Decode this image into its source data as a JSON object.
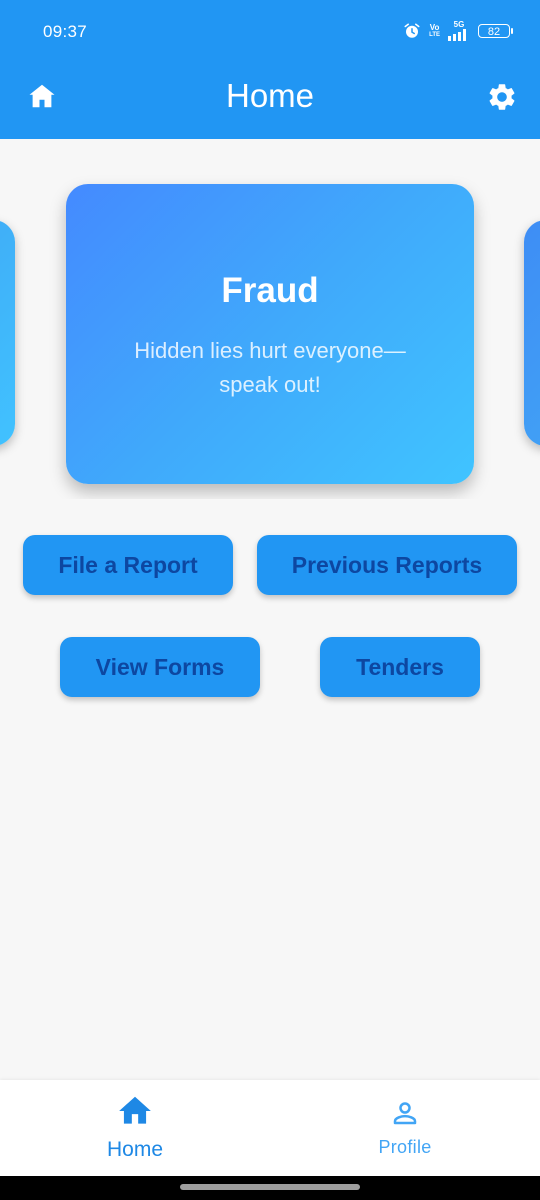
{
  "status_bar": {
    "time": "09:37",
    "icons": [
      "alarm-icon",
      "volte-icon",
      "signal-5g-icon",
      "battery-icon"
    ],
    "volte_top": "Vo",
    "volte_bottom": "LTE",
    "network": "5G",
    "battery": "82"
  },
  "app_bar": {
    "title": "Home",
    "left_icon": "home-icon",
    "right_icon": "settings-icon",
    "background": "#2196F3"
  },
  "carousel": {
    "current_card": {
      "title": "Fraud",
      "subtitle": "Hidden lies hurt everyone—speak out!"
    }
  },
  "actions": {
    "file_report": "File a Report",
    "previous_reports": "Previous Reports",
    "view_forms": "View Forms",
    "tenders": "Tenders"
  },
  "bottom_nav": {
    "items": [
      {
        "label": "Home",
        "icon": "home-icon",
        "selected": true
      },
      {
        "label": "Profile",
        "icon": "person-icon",
        "selected": false
      }
    ]
  },
  "colors": {
    "primary": "#2196F3",
    "button_text": "#0D47A1",
    "background": "#F7F7F7",
    "card_gradient_start": "#448AFF",
    "card_gradient_end": "#40C4FF"
  }
}
